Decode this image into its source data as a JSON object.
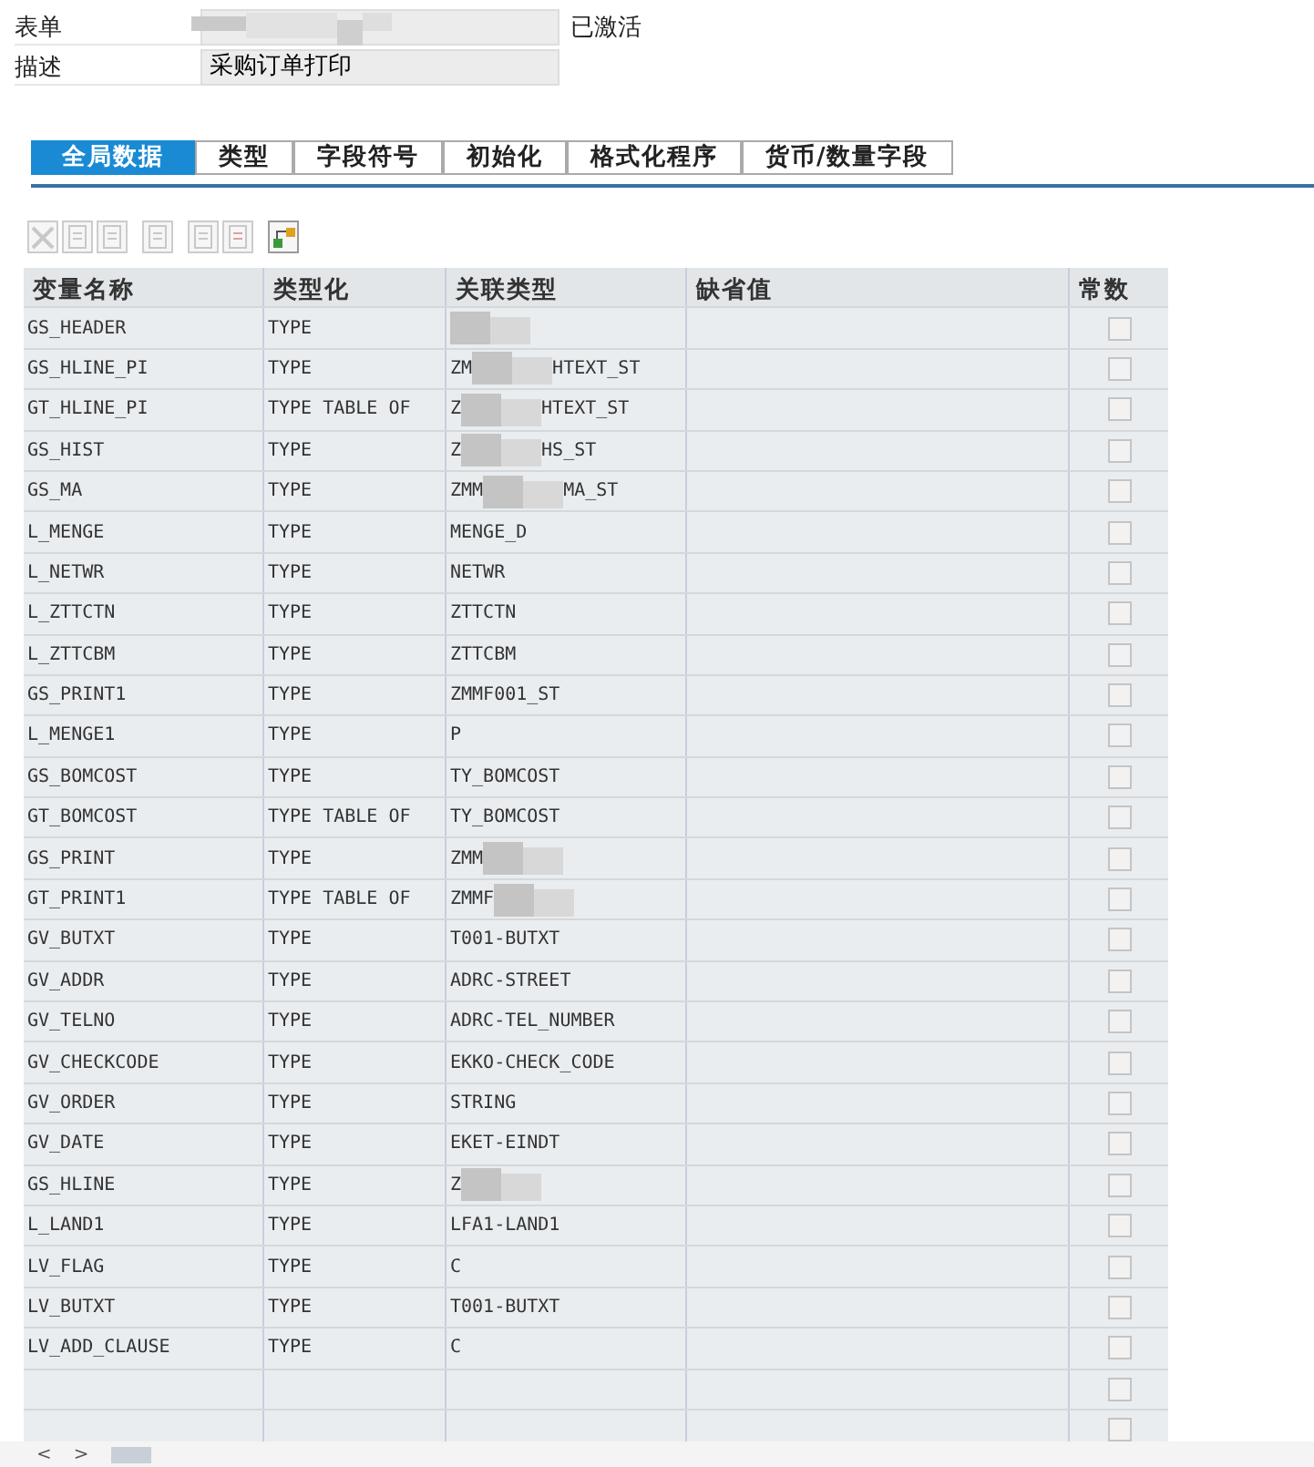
{
  "header": {
    "form_label": "表单",
    "form_value_redacted": true,
    "status": "已激活",
    "description_label": "描述",
    "description_value": "采购订单打印"
  },
  "tabs": [
    {
      "label": "全局数据",
      "selected": true
    },
    {
      "label": "类型",
      "selected": false
    },
    {
      "label": "字段符号",
      "selected": false
    },
    {
      "label": "初始化",
      "selected": false
    },
    {
      "label": "格式化程序",
      "selected": false
    },
    {
      "label": "货币/数量字段",
      "selected": false
    }
  ],
  "toolbar": [
    {
      "kind": "delete",
      "disabled": true
    },
    {
      "kind": "copy",
      "disabled": true
    },
    {
      "kind": "paste",
      "disabled": true
    },
    {
      "kind": "insert",
      "disabled": true
    },
    {
      "kind": "insert-row",
      "disabled": true
    },
    {
      "kind": "delete-row",
      "disabled": true
    },
    {
      "kind": "hierarchy",
      "disabled": false
    }
  ],
  "table": {
    "columns": [
      "变量名称",
      "类型化",
      "关联类型",
      "缺省值",
      "常数"
    ],
    "rows": [
      {
        "name": "GS_HEADER",
        "typing": "TYPE",
        "ref": [],
        "redacted": true,
        "constant": false
      },
      {
        "name": "GS_HLINE_PI",
        "typing": "TYPE",
        "ref": [
          "ZM",
          "HTEXT_ST"
        ],
        "redacted": true,
        "constant": false
      },
      {
        "name": "GT_HLINE_PI",
        "typing": "TYPE TABLE OF",
        "ref": [
          "Z",
          "HTEXT_ST"
        ],
        "redacted": true,
        "constant": false
      },
      {
        "name": "GS_HIST",
        "typing": "TYPE",
        "ref": [
          "Z",
          "HS_ST"
        ],
        "redacted": true,
        "constant": false
      },
      {
        "name": "GS_MA",
        "typing": "TYPE",
        "ref": [
          "ZMM",
          "MA_ST"
        ],
        "redacted": true,
        "constant": false
      },
      {
        "name": "L_MENGE",
        "typing": "TYPE",
        "ref": [
          "MENGE_D"
        ],
        "redacted": false,
        "constant": false
      },
      {
        "name": "L_NETWR",
        "typing": "TYPE",
        "ref": [
          "NETWR"
        ],
        "redacted": false,
        "constant": false
      },
      {
        "name": "L_ZTTCTN",
        "typing": "TYPE",
        "ref": [
          "ZTTCTN"
        ],
        "redacted": false,
        "constant": false
      },
      {
        "name": "L_ZTTCBM",
        "typing": "TYPE",
        "ref": [
          "ZTTCBM"
        ],
        "redacted": false,
        "constant": false
      },
      {
        "name": "GS_PRINT1",
        "typing": "TYPE",
        "ref": [
          "ZMMF001_ST"
        ],
        "redacted": false,
        "constant": false
      },
      {
        "name": "L_MENGE1",
        "typing": "TYPE",
        "ref": [
          "P"
        ],
        "redacted": false,
        "constant": false
      },
      {
        "name": "GS_BOMCOST",
        "typing": "TYPE",
        "ref": [
          "TY_BOMCOST"
        ],
        "redacted": false,
        "constant": false
      },
      {
        "name": "GT_BOMCOST",
        "typing": "TYPE TABLE OF",
        "ref": [
          "TY_BOMCOST"
        ],
        "redacted": false,
        "constant": false
      },
      {
        "name": "GS_PRINT",
        "typing": "TYPE",
        "ref": [
          "ZMM"
        ],
        "redacted": true,
        "constant": false
      },
      {
        "name": "GT_PRINT1",
        "typing": "TYPE TABLE OF",
        "ref": [
          "ZMMF"
        ],
        "redacted": true,
        "constant": false
      },
      {
        "name": "GV_BUTXT",
        "typing": "TYPE",
        "ref": [
          "T001-BUTXT"
        ],
        "redacted": false,
        "constant": false
      },
      {
        "name": "GV_ADDR",
        "typing": "TYPE",
        "ref": [
          "ADRC-STREET"
        ],
        "redacted": false,
        "constant": false
      },
      {
        "name": "GV_TELNO",
        "typing": "TYPE",
        "ref": [
          "ADRC-TEL_NUMBER"
        ],
        "redacted": false,
        "constant": false
      },
      {
        "name": "GV_CHECKCODE",
        "typing": "TYPE",
        "ref": [
          "EKKO-CHECK_CODE"
        ],
        "redacted": false,
        "constant": false
      },
      {
        "name": "GV_ORDER",
        "typing": "TYPE",
        "ref": [
          "STRING"
        ],
        "redacted": false,
        "constant": false
      },
      {
        "name": "GV_DATE",
        "typing": "TYPE",
        "ref": [
          "EKET-EINDT"
        ],
        "redacted": false,
        "constant": false
      },
      {
        "name": "GS_HLINE",
        "typing": "TYPE",
        "ref": [
          "Z"
        ],
        "redacted": true,
        "constant": false
      },
      {
        "name": "L_LAND1",
        "typing": "TYPE",
        "ref": [
          "LFA1-LAND1"
        ],
        "redacted": false,
        "constant": false
      },
      {
        "name": "LV_FLAG",
        "typing": "TYPE",
        "ref": [
          "C"
        ],
        "redacted": false,
        "constant": false
      },
      {
        "name": "LV_BUTXT",
        "typing": "TYPE",
        "ref": [
          "T001-BUTXT"
        ],
        "redacted": false,
        "constant": false
      },
      {
        "name": "LV_ADD_CLAUSE",
        "typing": "TYPE",
        "ref": [
          "C"
        ],
        "redacted": false,
        "constant": false
      },
      {
        "name": "",
        "typing": "",
        "ref": [],
        "redacted": false,
        "constant": false
      },
      {
        "name": "",
        "typing": "",
        "ref": [],
        "redacted": false,
        "constant": false
      }
    ]
  },
  "scrollbar": {
    "left": "<",
    "right": ">"
  }
}
